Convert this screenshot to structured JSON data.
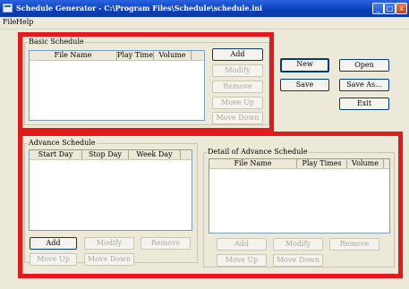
{
  "window": {
    "title": "Schedule Generator - C:\\Program Files\\Schedule\\schedule.ini",
    "controls": {
      "minimize": "_",
      "maximize": "□",
      "close": "x"
    }
  },
  "menu": {
    "items": [
      "File",
      "Help"
    ]
  },
  "basic_schedule": {
    "label": "Basic Schedule",
    "columns": [
      "File Name",
      "Play Times",
      "Volume"
    ],
    "buttons": {
      "add": "Add",
      "modify": "Modify",
      "remove": "Remove",
      "move_up": "Move Up",
      "move_down": "Move Down"
    }
  },
  "main_buttons": {
    "new": "New",
    "open": "Open",
    "save": "Save",
    "save_as": "Save As...",
    "exit": "Exit"
  },
  "advance_schedule": {
    "label": "Advance Schedule",
    "columns": [
      "Start Day",
      "Stop Day",
      "Week Day"
    ],
    "buttons": {
      "add": "Add",
      "modify": "Modify",
      "remove": "Remove",
      "move_up": "Move Up",
      "move_down": "Move Down"
    }
  },
  "detail_schedule": {
    "label": "Detail of Advance Schedule",
    "columns": [
      "File Name",
      "Play Times",
      "Volume"
    ],
    "buttons": {
      "add": "Add",
      "modify": "Modify",
      "remove": "Remove",
      "move_up": "Move Up",
      "move_down": "Move Down"
    }
  },
  "colors": {
    "highlight": "#e41a1a",
    "titlebar": "#0a3fb8",
    "face": "#ece9d8"
  }
}
